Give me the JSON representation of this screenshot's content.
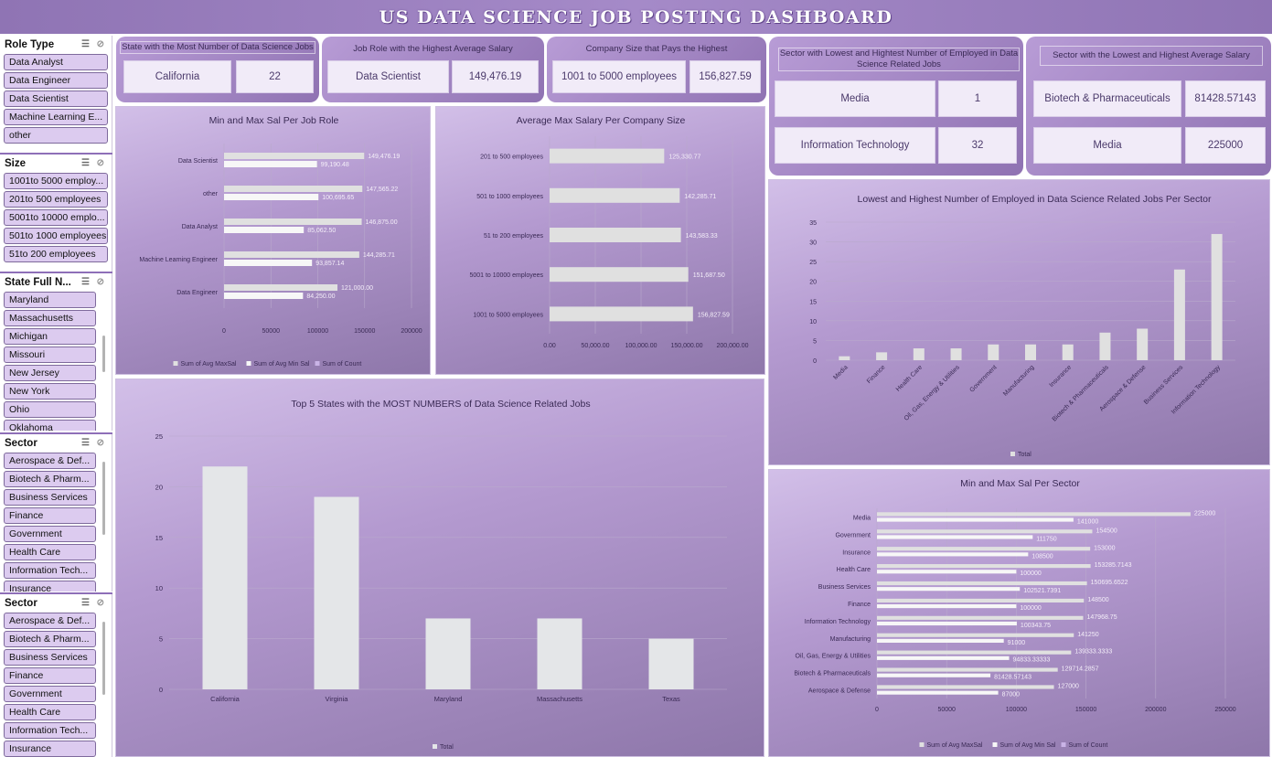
{
  "header": {
    "title": "US DATA SCIENCE JOB POSTING DASHBOARD"
  },
  "slicers": {
    "role_type": {
      "title": "Role Type",
      "items": [
        "Data Analyst",
        "Data Engineer",
        "Data Scientist",
        "Machine Learning E...",
        "other"
      ]
    },
    "size": {
      "title": "Size",
      "items": [
        "1001to 5000 employ...",
        "201to 500 employees",
        "5001to 10000 emplo...",
        "501to 1000 employees",
        "51to 200 employees"
      ]
    },
    "state": {
      "title": "State Full N...",
      "items": [
        "Maryland",
        "Massachusetts",
        "Michigan",
        "Missouri",
        "New Jersey",
        "New York",
        "Ohio",
        "Oklahoma"
      ]
    },
    "sector1": {
      "title": "Sector",
      "items": [
        "Aerospace & Def...",
        "Biotech & Pharm...",
        "Business Services",
        "Finance",
        "Government",
        "Health Care",
        "Information Tech...",
        "Insurance"
      ]
    },
    "sector2": {
      "title": "Sector",
      "items": [
        "Aerospace & Def...",
        "Biotech & Pharm...",
        "Business Services",
        "Finance",
        "Government",
        "Health Care",
        "Information Tech...",
        "Insurance"
      ]
    },
    "icons": {
      "multi_select": "multi-select-icon",
      "clear_filter": "clear-filter-icon"
    }
  },
  "kpis": {
    "state": {
      "title": "State with the Most Number of Data Science Jobs",
      "name": "California",
      "value": "22"
    },
    "role": {
      "title": "Job Role with the Highest Average Salary",
      "name": "Data Scientist",
      "value": "149,476.19"
    },
    "company": {
      "title": "Company Size that Pays the Highest",
      "name": "1001 to 5000 employees",
      "value": "156,827.59"
    },
    "sector_employed": {
      "title": "Sector with Lowest and Hightest Number of Employed in Data Science Related Jobs",
      "low_name": "Media",
      "low_value": "1",
      "high_name": "Information Technology",
      "high_value": "32"
    },
    "sector_salary": {
      "title": "Sector with the Lowest and Highest Average Salary",
      "low_name": "Biotech & Pharmaceuticals",
      "low_value": "81428.57143",
      "high_name": "Media",
      "high_value": "225000"
    }
  },
  "colors": {
    "header": "#9a7fc0",
    "bar_max": "#e0e0e0",
    "bar_min": "#f7f7f7",
    "bar_total": "#e4e6e8",
    "slicer_item": "#dccbef"
  },
  "chart_data": [
    {
      "id": "role",
      "type": "bar",
      "orientation": "horizontal",
      "title": "Min and Max Sal Per Job Role",
      "categories": [
        "Data Scientist",
        "other",
        "Data Analyst",
        "Machine Learning Engineer",
        "Data Engineer"
      ],
      "series": [
        {
          "name": "Sum of Avg MaxSal",
          "values": [
            149476.19,
            147565.22,
            146875.0,
            144285.71,
            121000.0
          ],
          "labels": [
            "149,476.19",
            "147,565.22",
            "146,875.00",
            "144,285.71",
            "121,000.00"
          ]
        },
        {
          "name": "Sum of Avg Min Sal",
          "values": [
            99190.48,
            100695.65,
            85062.5,
            93857.14,
            84250.0
          ],
          "labels": [
            "99,190.48",
            "100,695.65",
            "85,062.50",
            "93,857.14",
            "84,250.00"
          ]
        },
        {
          "name": "Sum of Count",
          "values": []
        }
      ],
      "xlim": [
        0,
        200000
      ],
      "xticks": [
        "0",
        "50000",
        "100000",
        "150000",
        "200000"
      ],
      "legend": "bottom"
    },
    {
      "id": "company",
      "type": "bar",
      "orientation": "horizontal",
      "title": "Average Max Salary Per Company Size",
      "categories": [
        "201 to 500 employees",
        "501 to 1000 employees",
        "51 to 200 employees",
        "5001 to 10000 employees",
        "1001 to 5000 employees"
      ],
      "values": [
        125330.77,
        142285.71,
        143583.33,
        151687.5,
        156827.59
      ],
      "labels": [
        "125,330.77",
        "142,285.71",
        "143,583.33",
        "151,687.50",
        "156,827.59"
      ],
      "xlim": [
        0,
        200000
      ],
      "xticks": [
        "0.00",
        "50,000.00",
        "100,000.00",
        "150,000.00",
        "200,000.00"
      ]
    },
    {
      "id": "employed",
      "type": "bar",
      "title": "Lowest and Highest Number of  Employed in Data Science Related Jobs Per Sector",
      "categories": [
        "Media",
        "Finance",
        "Health Care",
        "Oil, Gas, Energy & Utilities",
        "Government",
        "Manufacturing",
        "Insurance",
        "Biotech & Pharmaceuticals",
        "Aerospace & Defense",
        "Business Services",
        "Information Technology"
      ],
      "values": [
        1,
        2,
        3,
        3,
        4,
        4,
        4,
        7,
        8,
        23,
        32
      ],
      "ylim": [
        0,
        35
      ],
      "yticks": [
        "0",
        "5",
        "10",
        "15",
        "20",
        "25",
        "30",
        "35"
      ],
      "series_name": "Total",
      "legend": "bottom"
    },
    {
      "id": "states",
      "type": "bar",
      "title": "Top 5 States with the MOST NUMBERS of Data Science Related Jobs",
      "categories": [
        "California",
        "Virginia",
        "Maryland",
        "Massachusetts",
        "Texas"
      ],
      "values": [
        22,
        19,
        7,
        7,
        5
      ],
      "ylim": [
        0,
        25
      ],
      "yticks": [
        "0",
        "5",
        "10",
        "15",
        "20",
        "25"
      ],
      "series_name": "Total",
      "legend": "bottom"
    },
    {
      "id": "sector",
      "type": "bar",
      "orientation": "horizontal",
      "title": "Min and Max Sal Per Sector",
      "categories": [
        "Media",
        "Government",
        "Insurance",
        "Health Care",
        "Business Services",
        "Finance",
        "Information Technology",
        "Manufacturing",
        "Oil, Gas, Energy & Utilities",
        "Biotech & Pharmaceuticals",
        "Aerospace & Defense"
      ],
      "series": [
        {
          "name": "Sum of Avg MaxSal",
          "values": [
            225000,
            154500,
            153000,
            153285.7143,
            150695.6522,
            148500,
            147968.75,
            141250,
            139333.3333,
            129714.2857,
            127000
          ],
          "labels": [
            "225000",
            "154500",
            "153000",
            "153285.7143",
            "150695.6522",
            "148500",
            "147968.75",
            "141250",
            "139333.3333",
            "129714.2857",
            "127000"
          ]
        },
        {
          "name": "Sum of Avg Min Sal",
          "values": [
            141000,
            111750,
            108500,
            100000,
            102521.7391,
            100000,
            100343.75,
            91000,
            94833.33333,
            81428.57143,
            87000
          ],
          "labels": [
            "141000",
            "111750",
            "108500",
            "100000",
            "102521.7391",
            "100000",
            "100343.75",
            "91000",
            "94833.33333",
            "81428.57143",
            "87000"
          ]
        },
        {
          "name": "Sum of Count",
          "values": []
        }
      ],
      "xlim": [
        0,
        250000
      ],
      "xticks": [
        "0",
        "50000",
        "100000",
        "150000",
        "200000",
        "250000"
      ],
      "legend": "bottom"
    }
  ]
}
